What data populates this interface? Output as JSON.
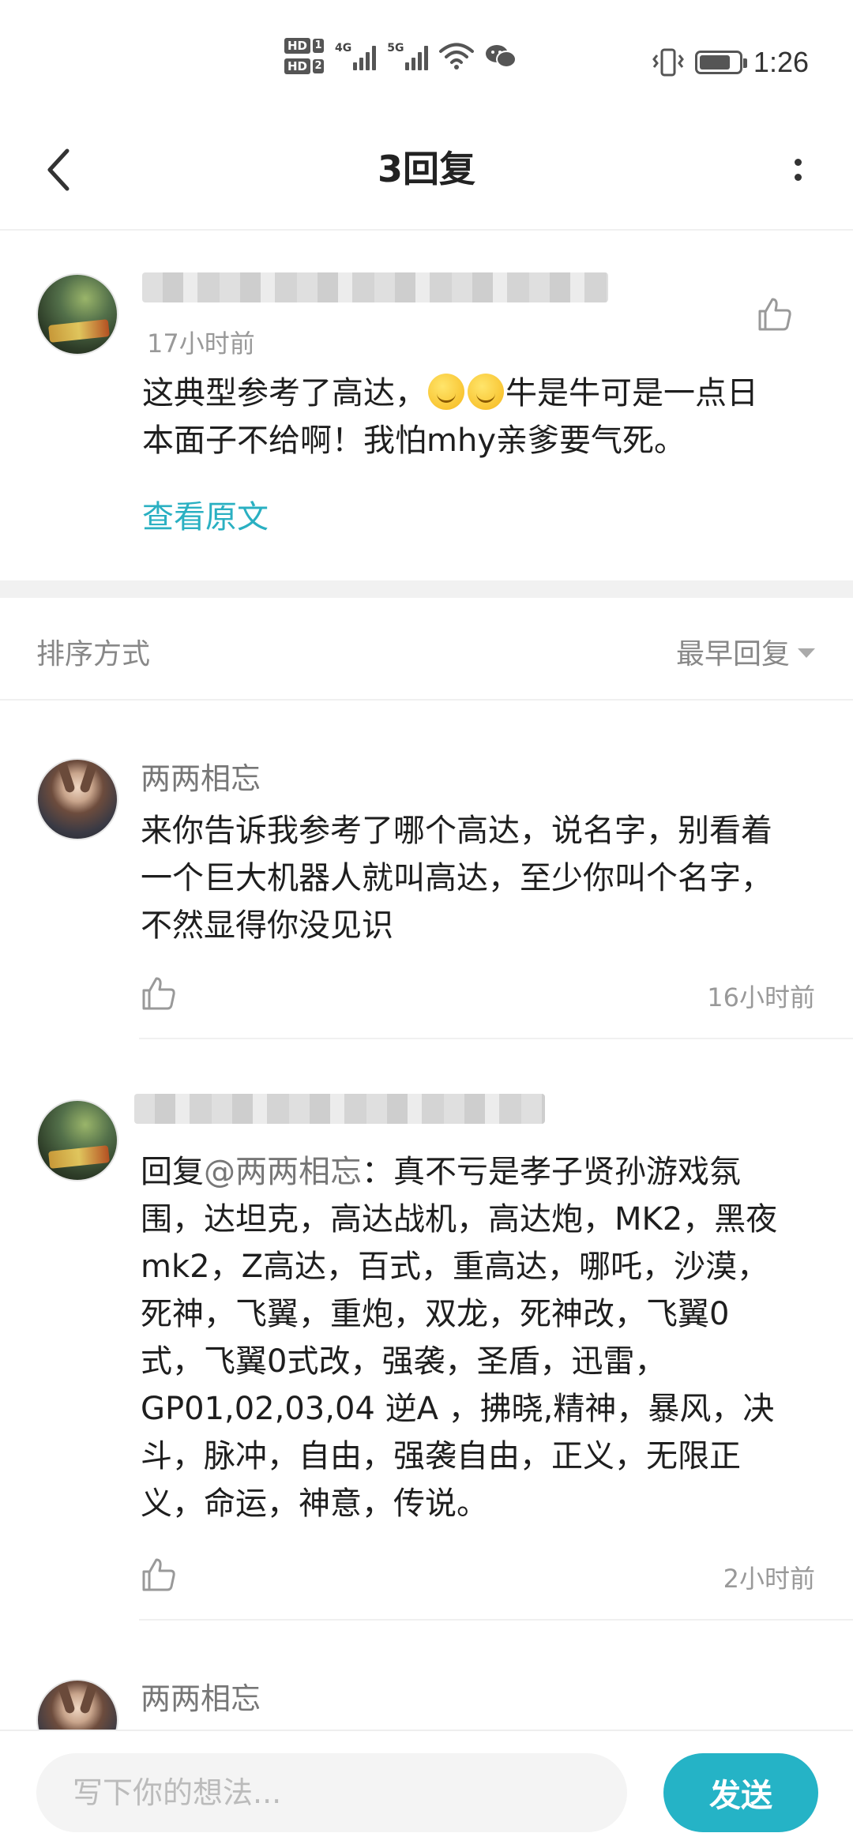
{
  "status_bar": {
    "hd1": "HD",
    "hd1_num": "1",
    "hd2": "HD",
    "hd2_num": "2",
    "net1": "4G",
    "net2": "5G",
    "time": "1:26",
    "battery_level": 0.8
  },
  "header": {
    "title": "3回复"
  },
  "original_post": {
    "time": "17小时前",
    "text_before_emoji": "这典型参考了高达，",
    "text_after_emoji": "牛是牛可是一点日",
    "text_line2": "本面子不给啊！我怕mhy亲爹要气死。",
    "view_original": "查看原文"
  },
  "sort": {
    "label": "排序方式",
    "selected": "最早回复"
  },
  "replies": [
    {
      "username": "两两相忘",
      "lines": [
        "来你告诉我参考了哪个高达，说名字，别看着",
        "一个巨大机器人就叫高达，至少你叫个名字，",
        "不然显得你没见识"
      ],
      "time": "16小时前"
    },
    {
      "reply_prefix": "回复",
      "mention": "@两两相忘",
      "lines": [
        "：真不亏是孝子贤孙游戏氛",
        "围，达坦克，高达战机，高达炮，MK2，黑夜",
        "mk2，Z高达，百式，重高达，哪吒，沙漠，",
        "死神，飞翼，重炮，双龙，死神改，飞翼0",
        "式，飞翼0式改，强袭，圣盾，迅雷，",
        "GP01,02,03,04 逆A ，拂晓,精神，暴风，决",
        "斗，脉冲，自由，强袭自由，正义，无限正",
        "义，命运，神意，传说。"
      ],
      "time": "2小时前"
    },
    {
      "username": "两两相忘"
    }
  ],
  "composer": {
    "placeholder": "写下你的想法...",
    "send_label": "发送"
  },
  "icons": {
    "back": "chevron-left-icon",
    "more": "more-vertical-icon",
    "like": "thumbs-up-icon",
    "sort": "caret-down-icon"
  },
  "colors": {
    "accent": "#25b3c6",
    "link": "#2ab0c2"
  }
}
